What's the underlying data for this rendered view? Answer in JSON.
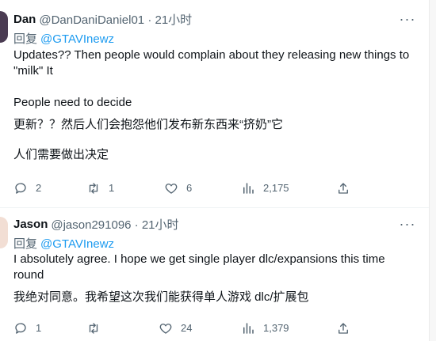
{
  "tweets": [
    {
      "name": "Dan",
      "handle": "@DanDaniDaniel01 · 21小时",
      "reply_prefix": "回复",
      "reply_to": "@GTAVInewz",
      "body": [
        "Updates?? Then people would complain about they releasing new things to \"milk\" It",
        "People need to decide",
        "更新？？然后人们会抱怨他们发布新东西来“挤奶”它",
        "人们需要做出决定"
      ],
      "actions": {
        "reply": "2",
        "retweet": "1",
        "like": "6",
        "views": "2,175"
      }
    },
    {
      "name": "Jason",
      "handle": "@jason291096 · 21小时",
      "reply_prefix": "回复",
      "reply_to": "@GTAVInewz",
      "body": [
        "I absolutely agree. I hope we get single player dlc/expansions this time round",
        "我绝对同意。我希望这次我们能获得单人游戏 dlc/扩展包"
      ],
      "actions": {
        "reply": "1",
        "retweet": "",
        "like": "24",
        "views": "1,379"
      }
    }
  ],
  "icons": [
    "reply-icon",
    "retweet-icon",
    "like-icon",
    "views-icon",
    "share-icon",
    "more-icon"
  ],
  "colors": {
    "text": "#0f1419",
    "secondary": "#536471",
    "link": "#1d9bf0"
  }
}
